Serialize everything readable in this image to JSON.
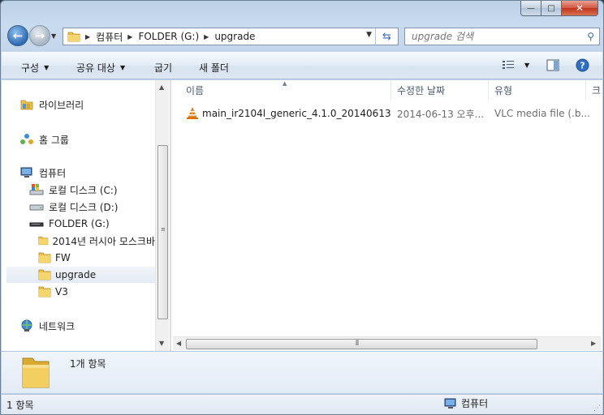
{
  "window": {
    "min_glyph": "—",
    "max_glyph": "□",
    "close_glyph": "✕"
  },
  "address": {
    "crumbs": [
      "컴퓨터",
      "FOLDER (G:)",
      "upgrade"
    ]
  },
  "search": {
    "placeholder": "upgrade 검색"
  },
  "toolbar": {
    "organize": "구성",
    "share": "공유 대상",
    "burn": "굽기",
    "new_folder": "새 폴더"
  },
  "nav": {
    "libraries": "라이브러리",
    "homegroup": "홈 그룹",
    "computer": "컴퓨터",
    "drive_c": "로컬 디스크 (C:)",
    "drive_d": "로컬 디스크 (D:)",
    "drive_g": "FOLDER (G:)",
    "folders": [
      "2014년 러시아 모스크바",
      "FW",
      "upgrade",
      "V3"
    ],
    "selected_folder": "upgrade",
    "network": "네트워크"
  },
  "columns": {
    "name": "이름",
    "modified": "수정한 날짜",
    "type": "유형",
    "size": "크"
  },
  "files": [
    {
      "name": "main_ir2104l_generic_4.1.0_20140613",
      "modified": "2014-06-13 오후...",
      "type": "VLC media file (.b..."
    }
  ],
  "details": {
    "item_count": "1개 항목"
  },
  "status": {
    "left": "1 항목",
    "right": "컴퓨터"
  },
  "colors": {
    "accent": "#3a6ea5",
    "folder": "#e8c14a",
    "vlc": "#f08a1c"
  }
}
